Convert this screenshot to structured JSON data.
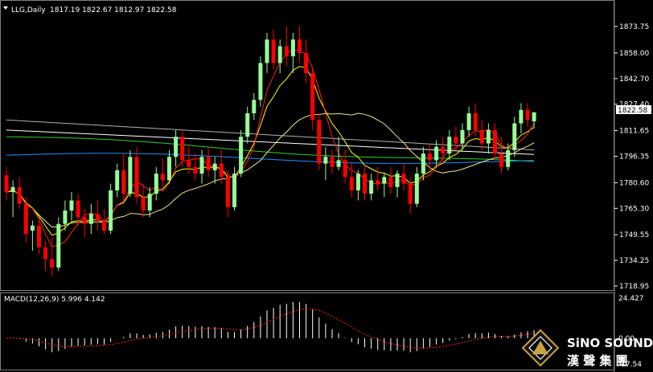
{
  "header": {
    "symbol_label": "LLG,Daily",
    "ohlc": "1817.19 1822.67 1812.97 1822.58"
  },
  "macd": {
    "label": "MACD(12,26,9) 5.996 4.142",
    "axis_labels": [
      "24.427",
      "0.00",
      "-17.54"
    ]
  },
  "price_axis": {
    "labels": [
      "1873.75",
      "1858.00",
      "1842.70",
      "1827.40",
      "1811.65",
      "1796.35",
      "1780.60",
      "1765.30",
      "1749.55",
      "1734.25",
      "1718.95"
    ],
    "current_price": "1822.58"
  },
  "watermark": {
    "line1": "SiNO SOUND",
    "line2": "漢 聲 集 團"
  },
  "colors": {
    "bull": "#98fb98",
    "bear": "#ff0000",
    "ma_fast": "#ffff00",
    "ma_red": "#ff2020",
    "ma_white": "#ffffff",
    "ma_gray": "#b0b0b0",
    "ma_green": "#32cd32",
    "ma_blue": "#1e90ff",
    "macd_signal": "#ff2020",
    "macd_hist": "#ffffff",
    "logo_gold": "#c8a040"
  },
  "chart_data": {
    "type": "candlestick",
    "ylim": [
      1718.95,
      1880
    ],
    "candles": [
      [
        1785,
        1790,
        1770,
        1775
      ],
      [
        1775,
        1782,
        1760,
        1778
      ],
      [
        1778,
        1784,
        1765,
        1768
      ],
      [
        1768,
        1772,
        1745,
        1750
      ],
      [
        1752,
        1758,
        1740,
        1755
      ],
      [
        1755,
        1760,
        1738,
        1742
      ],
      [
        1742,
        1746,
        1728,
        1735
      ],
      [
        1735,
        1748,
        1725,
        1730
      ],
      [
        1730,
        1760,
        1728,
        1756
      ],
      [
        1756,
        1770,
        1752,
        1764
      ],
      [
        1764,
        1775,
        1758,
        1770
      ],
      [
        1770,
        1774,
        1755,
        1760
      ],
      [
        1760,
        1765,
        1748,
        1756
      ],
      [
        1756,
        1768,
        1750,
        1762
      ],
      [
        1762,
        1770,
        1752,
        1758
      ],
      [
        1758,
        1765,
        1750,
        1752
      ],
      [
        1752,
        1780,
        1750,
        1776
      ],
      [
        1776,
        1792,
        1772,
        1788
      ],
      [
        1788,
        1798,
        1770,
        1774
      ],
      [
        1774,
        1800,
        1772,
        1796
      ],
      [
        1796,
        1802,
        1768,
        1772
      ],
      [
        1772,
        1780,
        1760,
        1764
      ],
      [
        1764,
        1778,
        1760,
        1774
      ],
      [
        1774,
        1790,
        1770,
        1786
      ],
      [
        1786,
        1795,
        1778,
        1782
      ],
      [
        1782,
        1800,
        1780,
        1796
      ],
      [
        1796,
        1812,
        1790,
        1808
      ],
      [
        1808,
        1812,
        1790,
        1794
      ],
      [
        1794,
        1802,
        1786,
        1790
      ],
      [
        1790,
        1798,
        1782,
        1786
      ],
      [
        1786,
        1800,
        1780,
        1796
      ],
      [
        1796,
        1802,
        1784,
        1788
      ],
      [
        1788,
        1796,
        1780,
        1792
      ],
      [
        1792,
        1800,
        1780,
        1784
      ],
      [
        1784,
        1788,
        1760,
        1766
      ],
      [
        1766,
        1790,
        1764,
        1786
      ],
      [
        1786,
        1812,
        1784,
        1808
      ],
      [
        1808,
        1826,
        1804,
        1822
      ],
      [
        1822,
        1834,
        1818,
        1830
      ],
      [
        1830,
        1856,
        1826,
        1852
      ],
      [
        1852,
        1870,
        1846,
        1866
      ],
      [
        1866,
        1872,
        1848,
        1852
      ],
      [
        1852,
        1866,
        1846,
        1862
      ],
      [
        1862,
        1874,
        1850,
        1856
      ],
      [
        1856,
        1870,
        1846,
        1866
      ],
      [
        1866,
        1874,
        1852,
        1858
      ],
      [
        1858,
        1866,
        1840,
        1846
      ],
      [
        1846,
        1850,
        1812,
        1818
      ],
      [
        1818,
        1822,
        1788,
        1792
      ],
      [
        1792,
        1802,
        1782,
        1796
      ],
      [
        1796,
        1800,
        1786,
        1790
      ],
      [
        1790,
        1808,
        1788,
        1794
      ],
      [
        1794,
        1800,
        1780,
        1784
      ],
      [
        1784,
        1792,
        1772,
        1776
      ],
      [
        1776,
        1788,
        1770,
        1786
      ],
      [
        1786,
        1790,
        1770,
        1774
      ],
      [
        1774,
        1786,
        1770,
        1782
      ],
      [
        1782,
        1790,
        1776,
        1780
      ],
      [
        1780,
        1786,
        1772,
        1784
      ],
      [
        1784,
        1790,
        1774,
        1778
      ],
      [
        1778,
        1788,
        1772,
        1786
      ],
      [
        1786,
        1792,
        1776,
        1780
      ],
      [
        1780,
        1784,
        1762,
        1768
      ],
      [
        1768,
        1790,
        1766,
        1786
      ],
      [
        1786,
        1802,
        1782,
        1798
      ],
      [
        1798,
        1804,
        1788,
        1794
      ],
      [
        1794,
        1806,
        1790,
        1802
      ],
      [
        1802,
        1808,
        1792,
        1798
      ],
      [
        1798,
        1812,
        1794,
        1808
      ],
      [
        1808,
        1814,
        1800,
        1804
      ],
      [
        1804,
        1816,
        1800,
        1812
      ],
      [
        1812,
        1826,
        1808,
        1822
      ],
      [
        1822,
        1828,
        1808,
        1812
      ],
      [
        1812,
        1818,
        1800,
        1804
      ],
      [
        1804,
        1816,
        1798,
        1812
      ],
      [
        1812,
        1816,
        1794,
        1798
      ],
      [
        1798,
        1808,
        1786,
        1790
      ],
      [
        1790,
        1804,
        1788,
        1800
      ],
      [
        1800,
        1820,
        1796,
        1816
      ],
      [
        1816,
        1828,
        1810,
        1824
      ],
      [
        1824,
        1828,
        1814,
        1818
      ],
      [
        1817.19,
        1822.67,
        1812.97,
        1822.58
      ]
    ]
  }
}
